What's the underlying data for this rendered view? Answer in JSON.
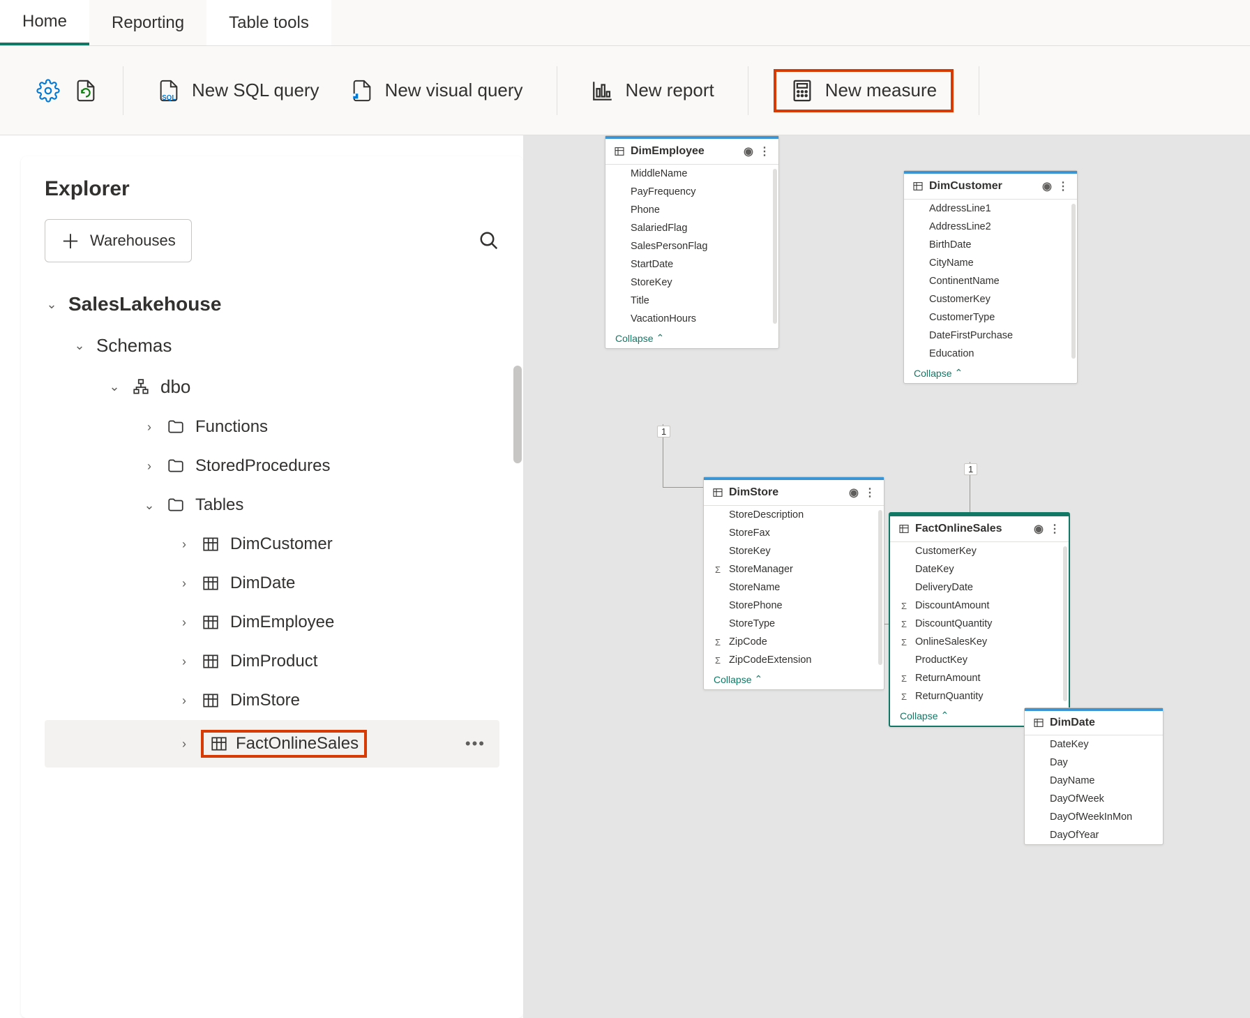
{
  "tabs": [
    "Home",
    "Reporting",
    "Table tools"
  ],
  "active_tab": 0,
  "secondary_active_tab": 2,
  "toolbar": {
    "new_sql_query": "New SQL query",
    "new_visual_query": "New visual query",
    "new_report": "New report",
    "new_measure": "New measure"
  },
  "explorer": {
    "title": "Explorer",
    "warehouses_btn": "Warehouses",
    "root": "SalesLakehouse",
    "schemas_label": "Schemas",
    "dbo_label": "dbo",
    "folders": {
      "functions": "Functions",
      "stored_procedures": "StoredProcedures",
      "tables": "Tables"
    },
    "tables": [
      "DimCustomer",
      "DimDate",
      "DimEmployee",
      "DimProduct",
      "DimStore",
      "FactOnlineSales"
    ]
  },
  "diagram": {
    "collapse_label": "Collapse",
    "DimEmployee": {
      "name": "DimEmployee",
      "fields": [
        {
          "name": "MiddleName",
          "sigma": false
        },
        {
          "name": "PayFrequency",
          "sigma": false
        },
        {
          "name": "Phone",
          "sigma": false
        },
        {
          "name": "SalariedFlag",
          "sigma": false
        },
        {
          "name": "SalesPersonFlag",
          "sigma": false
        },
        {
          "name": "StartDate",
          "sigma": false
        },
        {
          "name": "StoreKey",
          "sigma": false
        },
        {
          "name": "Title",
          "sigma": false
        },
        {
          "name": "VacationHours",
          "sigma": false
        }
      ]
    },
    "DimCustomer": {
      "name": "DimCustomer",
      "fields": [
        {
          "name": "AddressLine1",
          "sigma": false
        },
        {
          "name": "AddressLine2",
          "sigma": false
        },
        {
          "name": "BirthDate",
          "sigma": false
        },
        {
          "name": "CityName",
          "sigma": false
        },
        {
          "name": "ContinentName",
          "sigma": false
        },
        {
          "name": "CustomerKey",
          "sigma": false
        },
        {
          "name": "CustomerType",
          "sigma": false
        },
        {
          "name": "DateFirstPurchase",
          "sigma": false
        },
        {
          "name": "Education",
          "sigma": false
        }
      ]
    },
    "DimStore": {
      "name": "DimStore",
      "fields": [
        {
          "name": "StoreDescription",
          "sigma": false
        },
        {
          "name": "StoreFax",
          "sigma": false
        },
        {
          "name": "StoreKey",
          "sigma": false
        },
        {
          "name": "StoreManager",
          "sigma": true
        },
        {
          "name": "StoreName",
          "sigma": false
        },
        {
          "name": "StorePhone",
          "sigma": false
        },
        {
          "name": "StoreType",
          "sigma": false
        },
        {
          "name": "ZipCode",
          "sigma": true
        },
        {
          "name": "ZipCodeExtension",
          "sigma": true
        }
      ]
    },
    "FactOnlineSales": {
      "name": "FactOnlineSales",
      "fields": [
        {
          "name": "CustomerKey",
          "sigma": false
        },
        {
          "name": "DateKey",
          "sigma": false
        },
        {
          "name": "DeliveryDate",
          "sigma": false
        },
        {
          "name": "DiscountAmount",
          "sigma": true
        },
        {
          "name": "DiscountQuantity",
          "sigma": true
        },
        {
          "name": "OnlineSalesKey",
          "sigma": true
        },
        {
          "name": "ProductKey",
          "sigma": false
        },
        {
          "name": "ReturnAmount",
          "sigma": true
        },
        {
          "name": "ReturnQuantity",
          "sigma": true
        }
      ]
    },
    "DimDate": {
      "name": "DimDate",
      "fields": [
        {
          "name": "DateKey",
          "sigma": false
        },
        {
          "name": "Day",
          "sigma": false
        },
        {
          "name": "DayName",
          "sigma": false
        },
        {
          "name": "DayOfWeek",
          "sigma": false
        },
        {
          "name": "DayOfWeekInMon",
          "sigma": false
        },
        {
          "name": "DayOfYear",
          "sigma": false
        }
      ]
    }
  }
}
